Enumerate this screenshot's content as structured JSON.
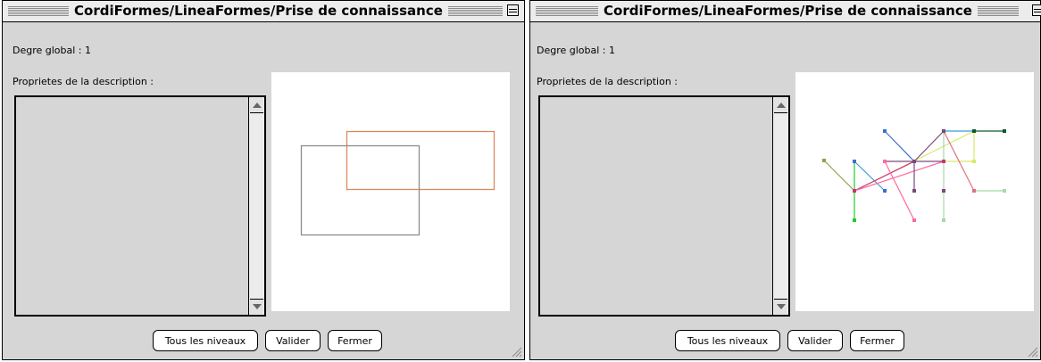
{
  "windows": [
    {
      "title": "CordiFormes/LineaFormes/Prise de connaissance",
      "degree_label": "Degre global : 1",
      "properties_label": "Proprietes de la description :",
      "buttons": {
        "all_levels": "Tous les niveaux",
        "validate": "Valider",
        "close": "Fermer"
      }
    },
    {
      "title": "CordiFormes/LineaFormes/Prise de connaissance",
      "degree_label": "Degre global : 1",
      "properties_label": "Proprietes de la description :",
      "buttons": {
        "all_levels": "Tous les niveaux",
        "validate": "Valider",
        "close": "Fermer"
      }
    }
  ],
  "colors": {
    "rect_orange": "#d9895a",
    "rect_gray": "#8c8c8c",
    "graph": {
      "blue": "#3a6fd0",
      "olive": "#9b9b4c",
      "pink": "#ff6aa0",
      "magenta": "#cc3377",
      "purple": "#7a4a7a",
      "green": "#22cc22",
      "lightgreen": "#a6d9a6",
      "yellowgreen": "#d8e86a",
      "darkgreen": "#0a5a2a",
      "salmon": "#e07080",
      "teal": "#3a9ad0"
    }
  }
}
